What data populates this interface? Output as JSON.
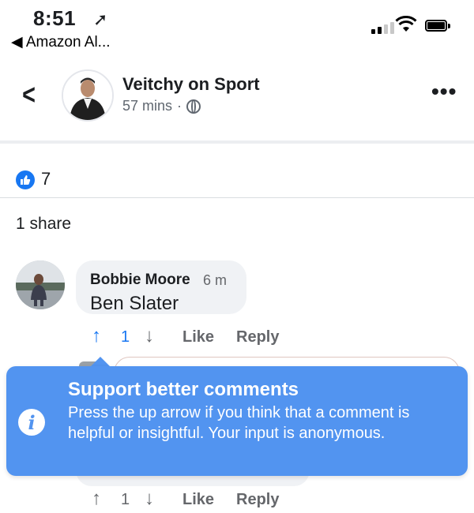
{
  "status_bar": {
    "time": "8:51",
    "back_app": "◀ Amazon Al..."
  },
  "header": {
    "page_name": "Veitchy on Sport",
    "post_time": "57 mins",
    "separator": "·",
    "more": "•••"
  },
  "reactions": {
    "like_count": "7",
    "shares": "1 share"
  },
  "comment": {
    "author": "Bobbie Moore",
    "time": "6 m",
    "text": "Ben Slater",
    "vote_count": "1",
    "like_label": "Like",
    "reply_label": "Reply"
  },
  "comment2": {
    "vote_count": "1",
    "like_label": "Like",
    "reply_label": "Reply"
  },
  "tooltip": {
    "title": "Support better comments",
    "body": "Press the up arrow if you think that a comment is helpful or insightful. Your input is anonymous."
  },
  "icons": {
    "back": "chevron-left-icon",
    "location": "location-arrow-icon",
    "audience": "globe-icon",
    "like": "thumbs-up-icon",
    "upvote": "up-arrow-icon",
    "downvote": "down-arrow-icon",
    "info": "info-icon"
  },
  "colors": {
    "accent": "#1877f2",
    "tooltip": "#5294f0"
  }
}
